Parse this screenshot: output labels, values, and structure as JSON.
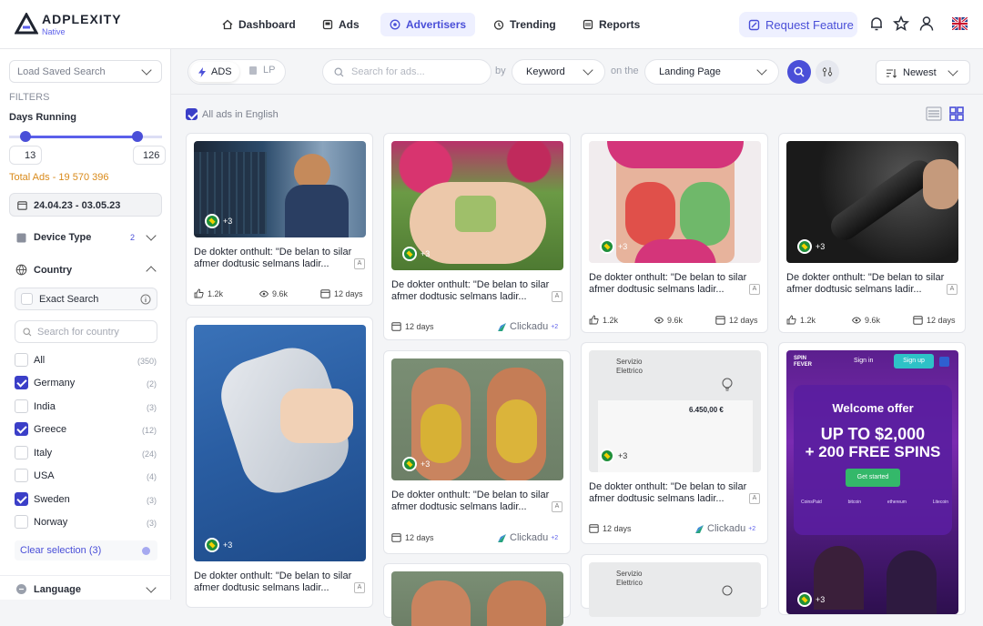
{
  "app": {
    "logo_title": "ADPLEXITY",
    "logo_subtitle": "Native"
  },
  "nav": {
    "dashboard": "Dashboard",
    "ads": "Ads",
    "advertisers": "Advertisers",
    "trending": "Trending",
    "reports": "Reports",
    "request_feature": "Request Feature"
  },
  "sidebar": {
    "load_saved_search": "Load Saved Search",
    "filters_label": "FILTERS",
    "days_running_label": "Days Running",
    "days_min": "13",
    "days_max": "126",
    "days_range": {
      "min": 13,
      "max": 126
    },
    "total_ads": "Total Ads - 19 570 396",
    "date_range": "24.04.23 - 03.05.23",
    "device_type": {
      "label": "Device Type",
      "count": "2"
    },
    "country": {
      "label": "Country",
      "exact_search": "Exact Search",
      "search_placeholder": "Search for country",
      "items": [
        {
          "name": "All",
          "count": "(350)",
          "checked": false
        },
        {
          "name": "Germany",
          "count": "(2)",
          "checked": true
        },
        {
          "name": "India",
          "count": "(3)",
          "checked": false
        },
        {
          "name": "Greece",
          "count": "(12)",
          "checked": true
        },
        {
          "name": "Italy",
          "count": "(24)",
          "checked": false
        },
        {
          "name": "USA",
          "count": "(4)",
          "checked": false
        },
        {
          "name": "Sweden",
          "count": "(3)",
          "checked": true
        },
        {
          "name": "Norway",
          "count": "(3)",
          "checked": false
        }
      ],
      "clear_selection": "Clear selection (3)"
    },
    "language": {
      "label": "Language"
    }
  },
  "toolbar": {
    "tab_ads": "ADS",
    "tab_lp": "LP",
    "search_placeholder": "Search for ads...",
    "by": "by",
    "keyword": "Keyword",
    "on_the": "on the",
    "landing_page": "Landing Page",
    "sort": "Newest",
    "english_only": "All ads in English"
  },
  "cards": [
    {
      "title": "De dokter onthult: \"De belan to silar afmer dodtusic selmans ladir...",
      "extra": "+3",
      "likes": "1.2k",
      "views": "9.6k",
      "days": "12 days"
    },
    {
      "title": "De dokter onthult: \"De belan to silar afmer dodtusic selmans ladir...",
      "extra": "+3",
      "days": "12 days",
      "network": "Clickadu",
      "network_extra": "+2"
    },
    {
      "title": "De dokter onthult: \"De belan to silar afmer dodtusic selmans ladir...",
      "extra": "+3",
      "likes": "1.2k",
      "views": "9.6k",
      "days": "12 days"
    },
    {
      "title": "De dokter onthult: \"De belan to silar afmer dodtusic selmans ladir...",
      "extra": "+3",
      "likes": "1.2k",
      "views": "9.6k",
      "days": "12 days"
    },
    {
      "title": "De dokter onthult: \"De belan to silar afmer dodtusic selmans ladir...",
      "extra": "+3"
    },
    {
      "title": "De dokter onthult: \"De belan to silar afmer dodtusic selmans ladir...",
      "extra": "+3",
      "days": "12 days",
      "network": "Clickadu",
      "network_extra": "+2"
    },
    {
      "title": "De dokter onthult: \"De belan to silar afmer dodtusic selmans ladir...",
      "extra": "+3",
      "days": "12 days",
      "network": "Clickadu",
      "network_extra": "+2"
    },
    {
      "extra": "+3",
      "casino": {
        "brand": "SPIN FEVER",
        "sign_in": "Sign in",
        "sign_up": "Sign up",
        "welcome": "Welcome offer",
        "headline1": "UP TO $2,000",
        "headline2": "+ 200 FREE SPINS",
        "cta": "Get started",
        "payments": [
          "CoinsPaid",
          "bitcoin",
          "ethereum",
          "Litecoin"
        ]
      }
    }
  ],
  "invoice_text": {
    "line1": "Servizio",
    "line2": "Elettrico",
    "amount": "6.450,00 €"
  },
  "colors": {
    "accent": "#4a4fd8",
    "orange": "#d98a1a"
  }
}
